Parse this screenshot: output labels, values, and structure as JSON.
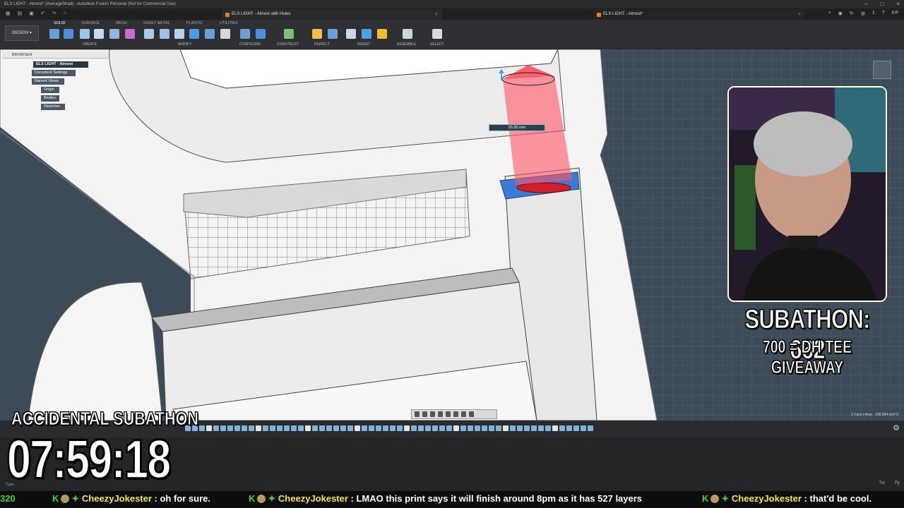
{
  "window": {
    "title": "ELS LIGHT - Almost* (AverageShad) - Autodesk Fusion Personal (Not for Commercial Use)"
  },
  "tabs": [
    {
      "label": "ELS LIGHT - Almost with Holes",
      "active": true
    },
    {
      "label": "ELS LIGHT - Almost*",
      "active": false
    }
  ],
  "tabbar_right": {
    "count": "1",
    "user": "KP"
  },
  "toolbar": {
    "workspace": "DESIGN",
    "tabs": [
      "SOLID",
      "SURFACE",
      "MESH",
      "SHEET METAL",
      "PLASTIC",
      "UTILITIES"
    ],
    "groups": [
      "CREATE",
      "MODIFY",
      "CONFIGURE",
      "CONSTRUCT",
      "INSPECT",
      "INSERT",
      "ASSEMBLE",
      "SELECT"
    ]
  },
  "browser": {
    "header": "BROWSER",
    "root": "ELS LIGHT - Almost",
    "items": [
      "Document Settings",
      "Named Views",
      "Origin",
      "Bodies",
      "Sketches"
    ]
  },
  "measure": {
    "value": "25.00 mm"
  },
  "status": {
    "selection": "1 Face | Area : 196.994 mm^2"
  },
  "overlay": {
    "subathon": "SUBATHON: 662",
    "giveaway": "700 = DH TEE GIVEAWAY",
    "accidental": "ACCIDENTAL SUBATHON",
    "timer": "07:59:18"
  },
  "lower": {
    "small_text": "Type",
    "right": [
      "Txt",
      "Py"
    ]
  },
  "chat": [
    {
      "prefix": "320",
      "user": "",
      "message": ""
    },
    {
      "user": "CheezyJokester",
      "message": "oh for sure."
    },
    {
      "user": "CheezyJokester",
      "message": "LMAO this print says it will finish around 8pm as it has 527 layers"
    },
    {
      "user": "CheezyJokester",
      "message": "that'd be cool."
    }
  ],
  "colors": {
    "grid": "#3d4a58",
    "model": "#f4f4f4",
    "extrude": "#ff5566",
    "accent_orange": "#f07a1a",
    "username": "#f2e640"
  }
}
